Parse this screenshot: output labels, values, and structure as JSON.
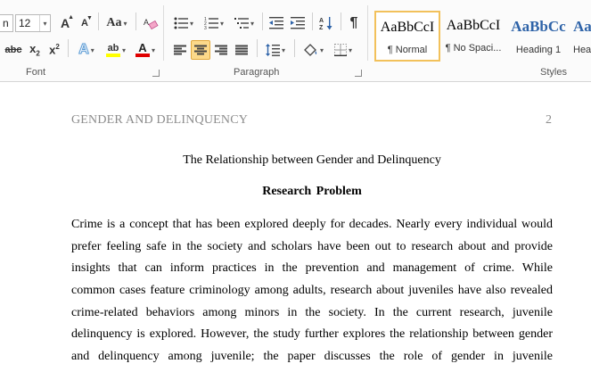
{
  "ribbon": {
    "font": {
      "name_partial": "n",
      "size": "12",
      "group_label": "Font"
    },
    "paragraph": {
      "group_label": "Paragraph"
    },
    "styles": {
      "group_label": "Styles",
      "items": [
        {
          "sample": "AaBbCcI",
          "name": "¶ Normal"
        },
        {
          "sample": "AaBbCcI",
          "name": "¶ No Spaci..."
        },
        {
          "sample": "AaBbCc",
          "name": "Heading 1"
        },
        {
          "sample": "AaBbCc",
          "name": "Hea"
        }
      ]
    },
    "glyphs": {
      "grow": "A",
      "shrink": "A",
      "case": "Aa",
      "strike": "abc",
      "sub": "x",
      "sub_mark": "2",
      "sup": "x",
      "sup_mark": "2",
      "effects": "A",
      "highlight": "ab",
      "color": "A",
      "pilcrow": "¶"
    },
    "colors": {
      "highlight": "#ffff00",
      "font_color": "#e00000",
      "text_effects": "#5b9bd5"
    }
  },
  "document": {
    "header_title": "GENDER AND DELINQUENCY",
    "page_number": "2",
    "title": "The Relationship between Gender and Delinquency",
    "heading": "Research Problem",
    "paragraph_lines": [
      "Crime is a concept that has been explored deeply for decades. Nearly every individual would",
      "prefer feeling safe in the society and scholars have been out to research about and provide",
      "insights that can inform practices in the prevention and management of crime. While",
      "common cases feature criminology among adults, research about juveniles have also revealed",
      "crime-related behaviors among minors in the society. In the current research, juvenile",
      "delinquency is explored. However, the study further explores the relationship between gender",
      "and delinquency among juvenile; the paper discusses the role of gender in juvenile"
    ]
  }
}
